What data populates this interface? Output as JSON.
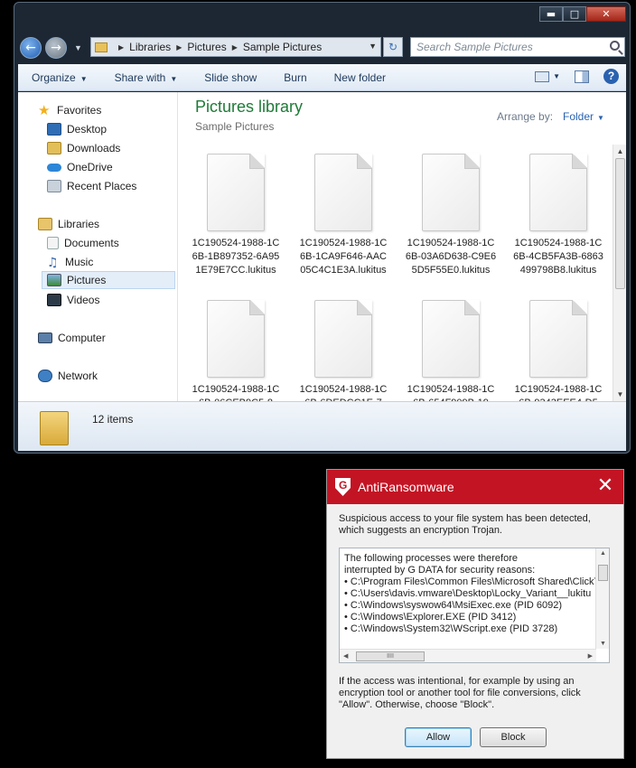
{
  "window_controls": {
    "minimize": "▬",
    "maximize": "□",
    "close": "✕"
  },
  "address": {
    "crumbs": [
      "Libraries",
      "Pictures",
      "Sample Pictures"
    ],
    "search_placeholder": "Search Sample Pictures"
  },
  "toolbar": {
    "organize": "Organize",
    "share_with": "Share with",
    "slide_show": "Slide show",
    "burn": "Burn",
    "new_folder": "New folder",
    "help": "?"
  },
  "nav": {
    "favorites": "Favorites",
    "desktop": "Desktop",
    "downloads": "Downloads",
    "onedrive": "OneDrive",
    "recent_places": "Recent Places",
    "libraries": "Libraries",
    "documents": "Documents",
    "music": "Music",
    "pictures": "Pictures",
    "videos": "Videos",
    "computer": "Computer",
    "network": "Network"
  },
  "library": {
    "title": "Pictures library",
    "subtitle": "Sample Pictures",
    "arrange_label": "Arrange by:",
    "arrange_value": "Folder"
  },
  "files": [
    "1C190524-1988-1C6B-1B897352-6A951E79E7CC.lukitus",
    "1C190524-1988-1C6B-1CA9F646-AAC05C4C1E3A.lukitus",
    "1C190524-1988-1C6B-03A6D638-C9E65D5F55E0.lukitus",
    "1C190524-1988-1C6B-4CB5FA3B-6863499798B8.lukitus",
    "1C190524-1988-1C6B-06CEB9C5-8",
    "1C190524-1988-1C6B-6DEDCC1E-7",
    "1C190524-1988-1C6B-654F909B-19",
    "1C190524-1988-1C6B-9343EEE4-D5"
  ],
  "details": {
    "item_count": "12 items"
  },
  "dialog": {
    "title": "AntiRansomware",
    "close": "✕",
    "message_top": "Suspicious access to your file system has been detected, which suggests an encryption Trojan.",
    "process_lines": [
      "The following processes were therefore",
      "interrupted by G DATA for security reasons:",
      "• C:\\Program Files\\Common Files\\Microsoft Shared\\ClickT",
      "• C:\\Users\\davis.vmware\\Desktop\\Locky_Variant__lukitu",
      "• C:\\Windows\\syswow64\\MsiExec.exe (PID 6092)",
      "• C:\\Windows\\Explorer.EXE (PID 3412)",
      "• C:\\Windows\\System32\\WScript.exe (PID 3728)"
    ],
    "message_bottom": "If the access was intentional, for example by using an encryption tool or another tool for file conversions, click \"Allow\". Otherwise, choose \"Block\".",
    "allow": "Allow",
    "block": "Block",
    "hscroll_grip": "IIII"
  },
  "colors": {
    "accent_red": "#c31424",
    "library_green": "#1e7b37",
    "link_blue": "#2a62b0"
  }
}
